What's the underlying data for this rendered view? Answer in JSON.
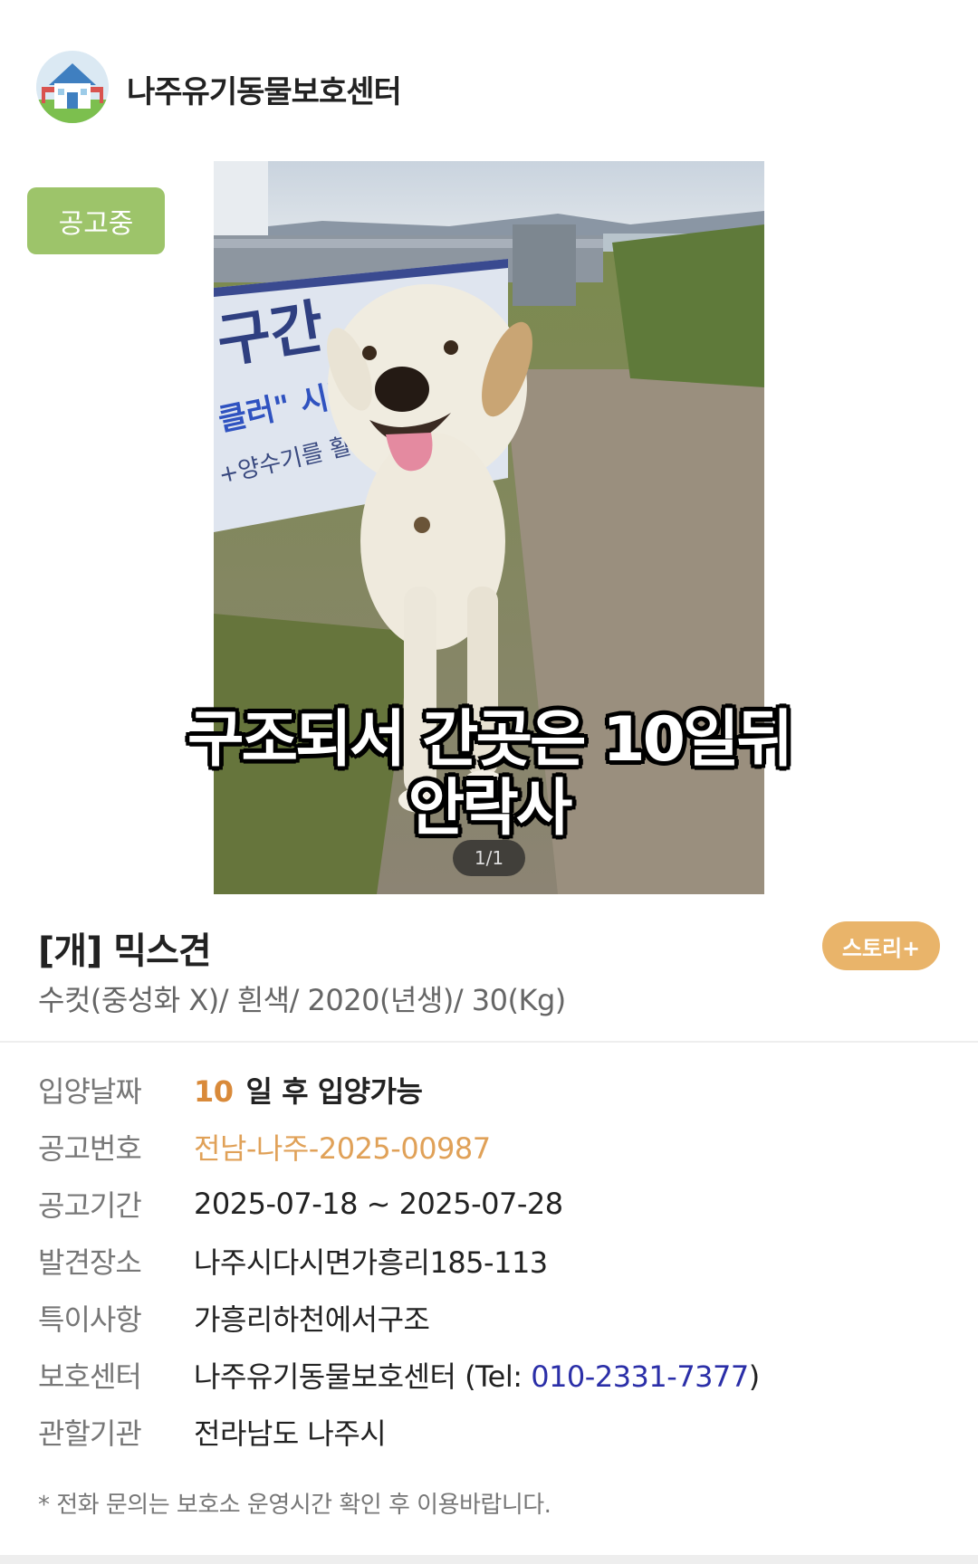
{
  "header": {
    "center_name": "나주유기동물보호센터",
    "logo_icon": "house-icon"
  },
  "status_badge": "공고중",
  "photo": {
    "caption_line1": "구조되서 간곳은 10일뒤",
    "caption_line2": "안락사",
    "page_indicator": "1/1",
    "sign_text_1": "구간",
    "sign_text_2": "클러\" 시범",
    "sign_text_3": "+양수기를 활"
  },
  "animal": {
    "breed": "[개] 믹스견",
    "summary": "수컷(중성화 X)/ 흰색/ 2020(년생)/ 30(Kg)",
    "story_button": "스토리+"
  },
  "info": {
    "adoption_date": {
      "label": "입양날짜",
      "days": "10",
      "text": "일 후 입양가능"
    },
    "notice_no": {
      "label": "공고번호",
      "value": "전남-나주-2025-00987"
    },
    "notice_period": {
      "label": "공고기간",
      "value": "2025-07-18 ~ 2025-07-28"
    },
    "found_place": {
      "label": "발견장소",
      "value": "나주시다시면가흥리185-113"
    },
    "special_notes": {
      "label": "특이사항",
      "value": "가흥리하천에서구조"
    },
    "shelter": {
      "label": "보호센터",
      "value_prefix": "나주유기동물보호센터 (Tel: ",
      "tel": "010-2331-7377",
      "value_suffix": ")"
    },
    "jurisdiction": {
      "label": "관할기관",
      "value": "전라남도 나주시"
    }
  },
  "footnote": "* 전화 문의는 보호소 운영시간 확인 후 이용바랍니다.",
  "colors": {
    "badge_green": "#9dc46a",
    "story_orange": "#e9b46a",
    "highlight_orange": "#d98a3a",
    "tel_blue": "#2b2fa8"
  }
}
